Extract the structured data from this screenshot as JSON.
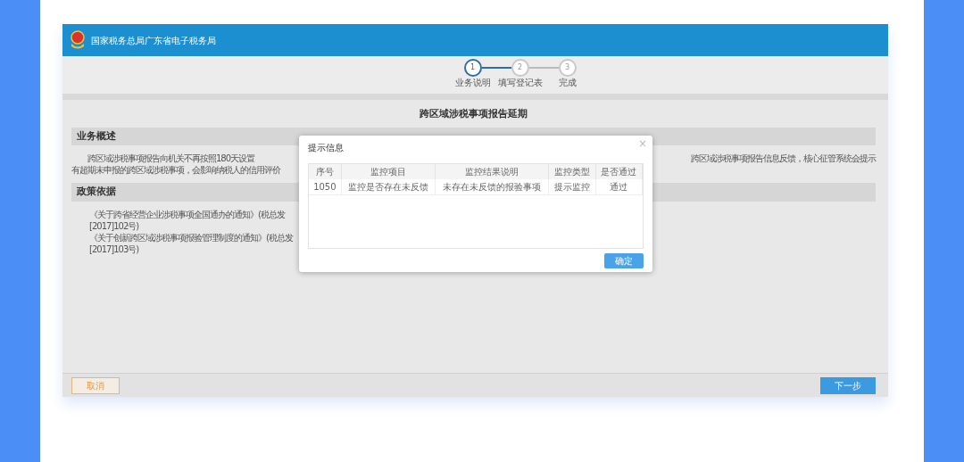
{
  "header": {
    "title": "国家税务总局广东省电子税务局"
  },
  "steps": [
    {
      "number": "1",
      "label": "业务说明",
      "selected": true
    },
    {
      "number": "2",
      "label": "填写登记表",
      "selected": false
    },
    {
      "number": "3",
      "label": "完成",
      "selected": false
    }
  ],
  "page_title": "跨区域涉税事项报告延期",
  "sections": [
    {
      "kind": "overview",
      "heading": "业务概述",
      "lines": [
        [
          "跨区域涉税事项报告向机关不再按照180天设置",
          "跨区域涉税事项报告信息反馈，核心征管系统会提示"
        ],
        [
          "有超期未申报的跨区域涉税事项，会影响纳税人的信用评价"
        ]
      ]
    },
    {
      "kind": "policy",
      "heading": "政策依据",
      "lines": [
        [
          "《关于跨省经营企业涉税事项全国通办的通知》(税总发[2017]102号)"
        ],
        [
          "《关于创新跨区域涉税事项报验管理制度的通知》(税总发[2017]103号)"
        ]
      ]
    }
  ],
  "dialog": {
    "title": "提示信息",
    "close": "×",
    "columns": [
      "序号",
      "监控项目",
      "监控结果说明",
      "监控类型",
      "是否通过"
    ],
    "rows": [
      [
        "1050",
        "监控是否存在未反馈",
        "未存在未反馈的报验事项",
        "提示监控",
        "通过"
      ]
    ],
    "ok": "确定"
  },
  "footer": {
    "cancel": "取消",
    "next": "下一步"
  }
}
